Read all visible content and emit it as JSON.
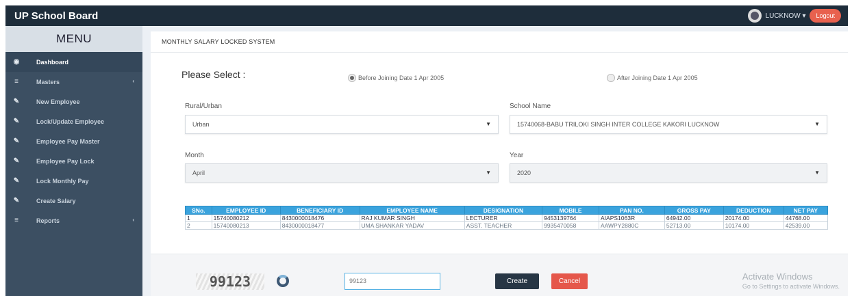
{
  "app": {
    "title": "UP School Board"
  },
  "header": {
    "location": "LUCKNOW",
    "logout_label": "Logout"
  },
  "sidebar": {
    "menu_title": "MENU",
    "items": [
      {
        "label": "Dashboard",
        "icon": "dashboard-icon",
        "has_children": false,
        "active": true
      },
      {
        "label": "Masters",
        "icon": "list-icon",
        "has_children": true,
        "active": false
      },
      {
        "label": "New Employee",
        "icon": "pencil-icon",
        "has_children": false,
        "active": false
      },
      {
        "label": "Lock/Update Employee",
        "icon": "pencil-icon",
        "has_children": false,
        "active": false
      },
      {
        "label": "Employee Pay Master",
        "icon": "pencil-icon",
        "has_children": false,
        "active": false
      },
      {
        "label": "Employee Pay Lock",
        "icon": "pencil-icon",
        "has_children": false,
        "active": false
      },
      {
        "label": "Lock Monthly Pay",
        "icon": "pencil-icon",
        "has_children": false,
        "active": false
      },
      {
        "label": "Create Salary",
        "icon": "pencil-icon",
        "has_children": false,
        "active": false
      },
      {
        "label": "Reports",
        "icon": "list-icon",
        "has_children": true,
        "active": false
      }
    ]
  },
  "panel": {
    "title": "MONTHLY SALARY LOCKED SYSTEM",
    "please_select": "Please Select :",
    "radio_before": "Before Joining Date 1 Apr 2005",
    "radio_after": "After Joining Date 1 Apr 2005",
    "rural_urban_label": "Rural/Urban",
    "rural_urban_value": "Urban",
    "school_name_label": "School Name",
    "school_name_value": "15740068-BABU TRILOKI SINGH INTER COLLEGE KAKORI LUCKNOW",
    "month_label": "Month",
    "month_value": "April",
    "year_label": "Year",
    "year_value": "2020"
  },
  "table": {
    "columns": [
      "SNo.",
      "EMPLOYEE ID",
      "BENEFICIARY ID",
      "EMPLOYEE NAME",
      "DESIGNATION",
      "MOBILE",
      "PAN NO.",
      "GROSS PAY",
      "DEDUCTION",
      "NET PAY"
    ],
    "rows": [
      [
        "1",
        "15740080212",
        "8430000018476",
        "RAJ KUMAR SINGH",
        "LECTURER",
        "9453139764",
        "AIAPS1063R",
        "64942.00",
        "20174.00",
        "44768.00"
      ],
      [
        "2",
        "15740080213",
        "8430000018477",
        "UMA SHANKAR YADAV",
        "ASST. TEACHER",
        "9935470058",
        "AAWPY2880C",
        "52713.00",
        "10174.00",
        "42539.00"
      ]
    ]
  },
  "footer": {
    "captcha_text": "99123",
    "captcha_input_value": "99123",
    "create_label": "Create",
    "cancel_label": "Cancel",
    "watermark_title": "Activate Windows",
    "watermark_sub": "Go to Settings to activate Windows."
  },
  "colors": {
    "topbar": "#1e2d3b",
    "sidebar": "#3c4f62",
    "table_header": "#3aa3dd",
    "cancel": "#e5574b",
    "create": "#273645",
    "logout": "#e8614e"
  }
}
